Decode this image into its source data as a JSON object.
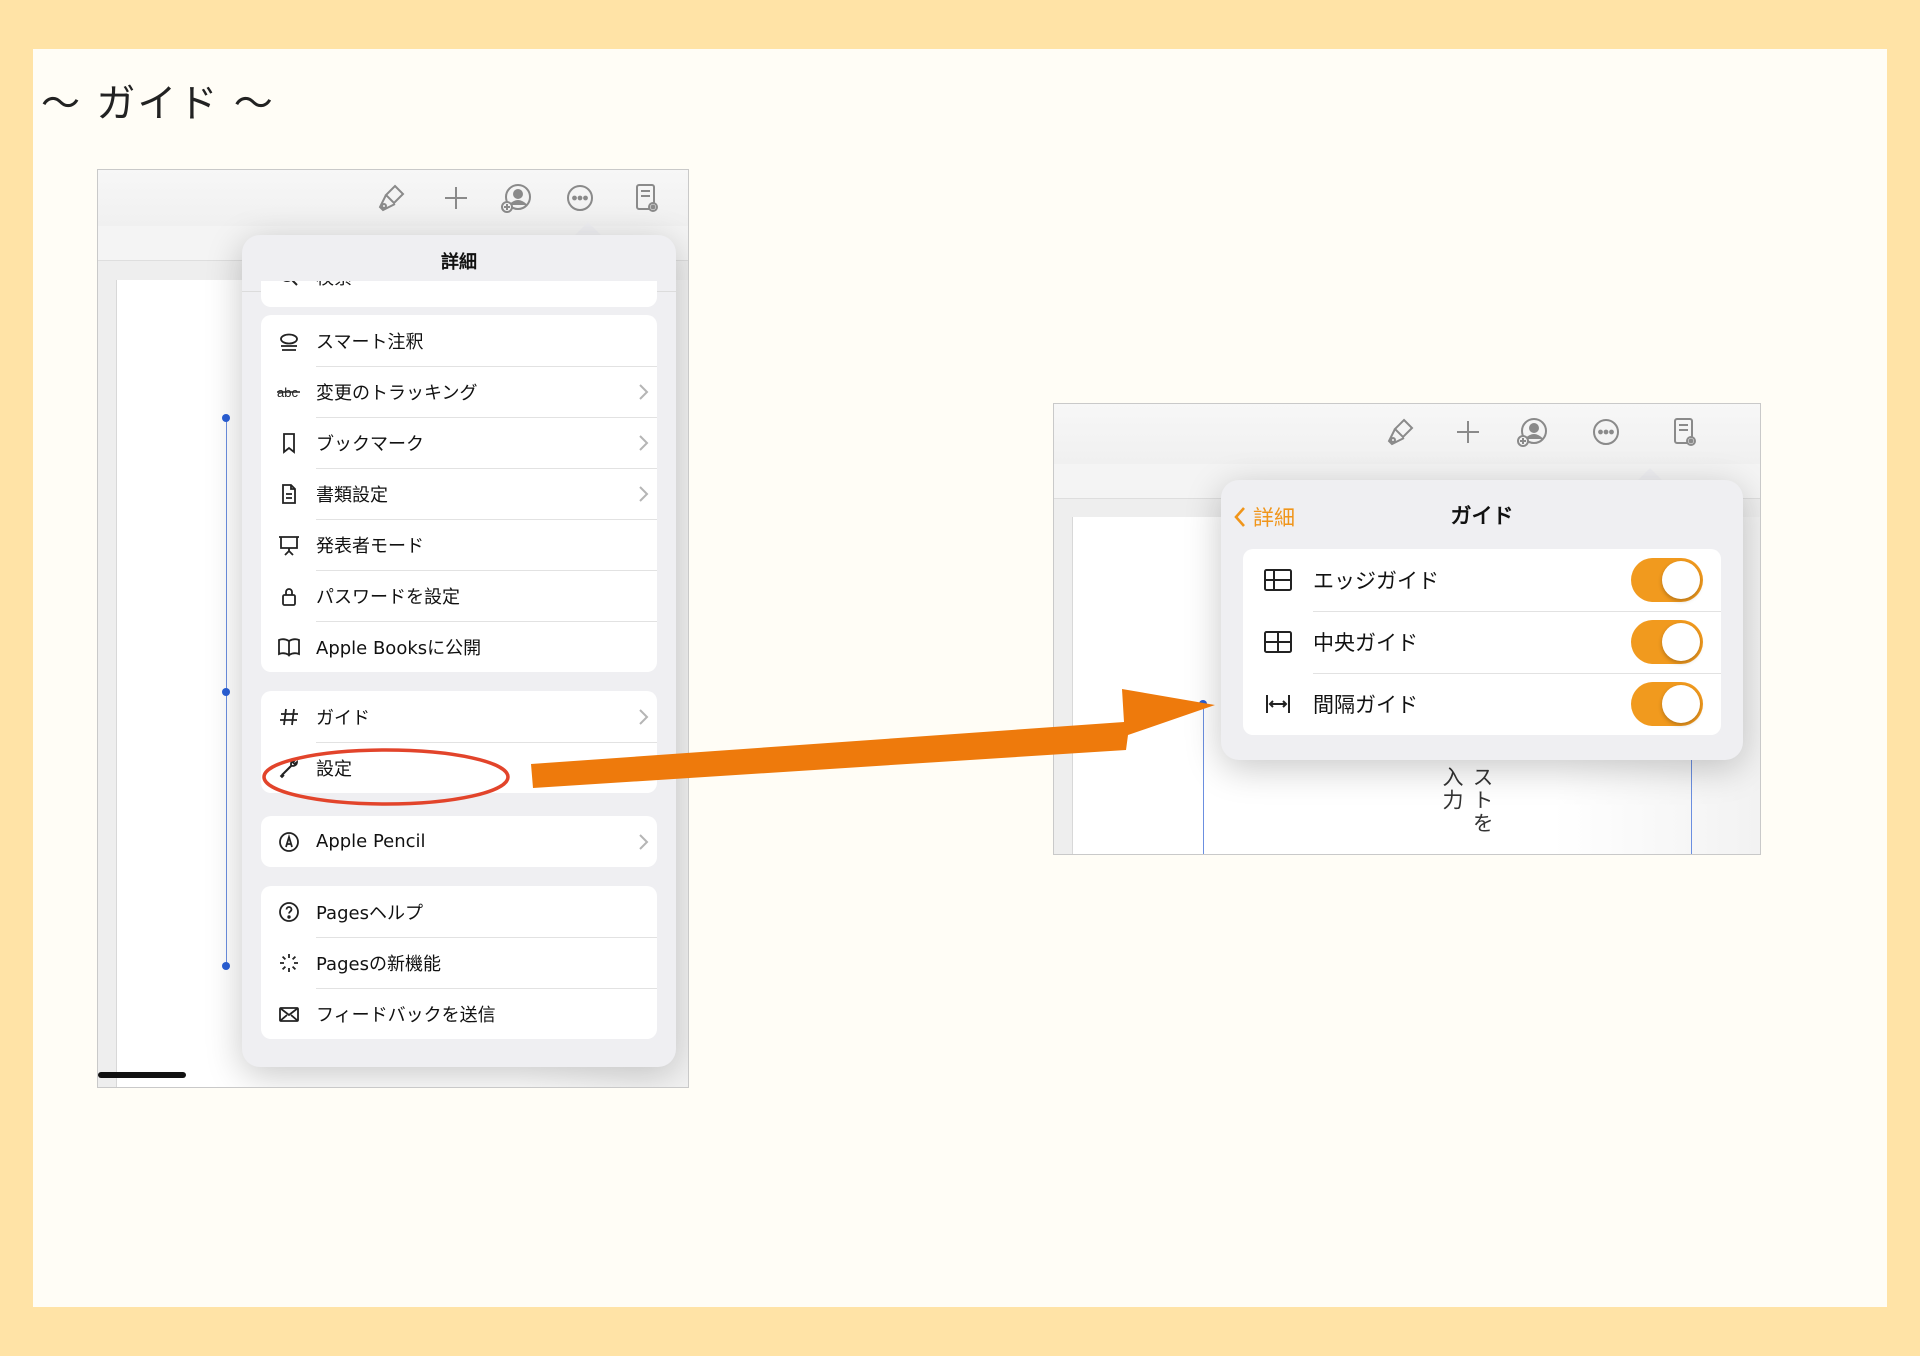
{
  "slide": {
    "title": "〜 ガイド 〜"
  },
  "left_shot": {
    "popover_title": "詳細",
    "partial_item": "検索",
    "group1": [
      {
        "label": "スマート注釈",
        "icon": "smart-annotation-icon",
        "chevron": false
      },
      {
        "label": "変更のトラッキング",
        "icon": "abc-strikethrough-icon",
        "chevron": true
      },
      {
        "label": "ブックマーク",
        "icon": "bookmark-icon",
        "chevron": true
      },
      {
        "label": "書類設定",
        "icon": "document-icon",
        "chevron": true
      },
      {
        "label": "発表者モード",
        "icon": "presenter-icon",
        "chevron": false
      },
      {
        "label": "パスワードを設定",
        "icon": "lock-icon",
        "chevron": false
      },
      {
        "label": "Apple Booksに公開",
        "icon": "book-icon",
        "chevron": false
      }
    ],
    "group2": [
      {
        "label": "ガイド",
        "icon": "hash-icon",
        "chevron": true
      },
      {
        "label": "設定",
        "icon": "wrench-icon",
        "chevron": true
      }
    ],
    "group3": [
      {
        "label": "Apple Pencil",
        "icon": "pencil-circle-icon",
        "chevron": true
      }
    ],
    "group4": [
      {
        "label": "Pagesヘルプ",
        "icon": "help-icon",
        "chevron": false
      },
      {
        "label": "Pagesの新機能",
        "icon": "sparkle-icon",
        "chevron": false
      },
      {
        "label": "フィードバックを送信",
        "icon": "envelope-icon",
        "chevron": false
      }
    ]
  },
  "right_shot": {
    "back_label": "詳細",
    "popover_title": "ガイド",
    "rows": [
      {
        "label": "エッジガイド",
        "icon": "edge-guide-icon",
        "on": true
      },
      {
        "label": "中央ガイド",
        "icon": "center-guide-icon",
        "on": true
      },
      {
        "label": "間隔ガイド",
        "icon": "spacing-guide-icon",
        "on": true
      }
    ],
    "doc_text": "ストを入力"
  },
  "colors": {
    "slide_border": "#FFE3A6",
    "accent_orange": "#F19A1E",
    "arrow_orange": "#EE7A0C",
    "highlight_red": "#E2442B",
    "guide_blue": "#2A5FD6"
  }
}
